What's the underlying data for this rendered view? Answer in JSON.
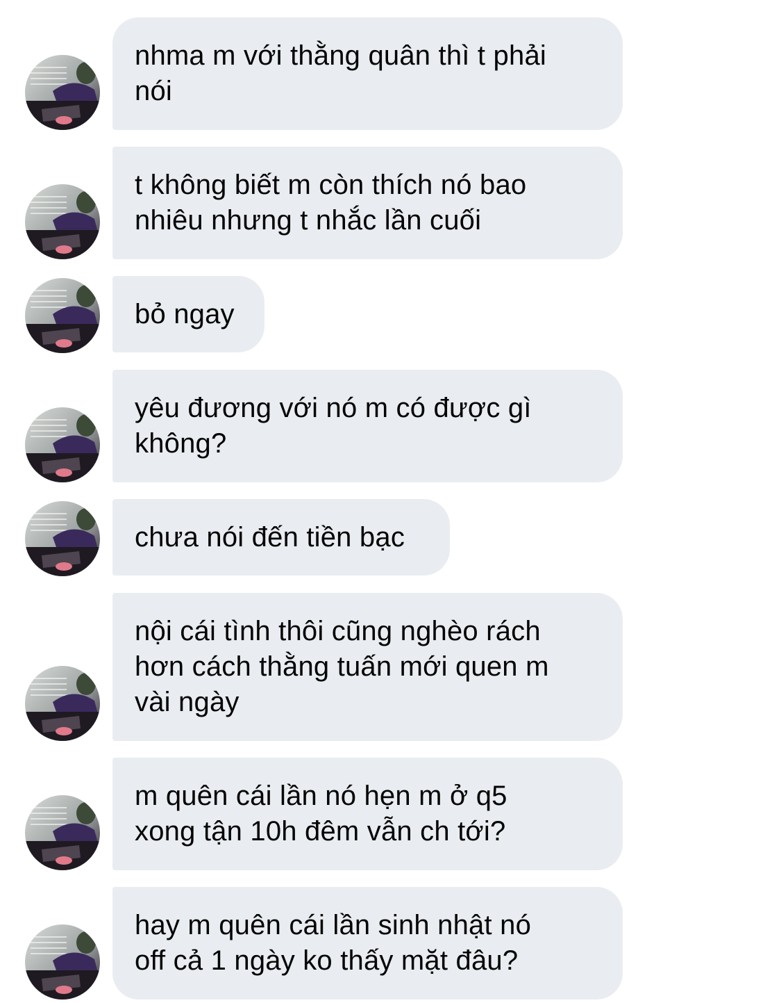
{
  "conversation": {
    "messages": [
      {
        "text": "nhma m với thằng quân thì t phải\nnói",
        "avatar": "profile-photo"
      },
      {
        "text": "t không biết m còn thích nó bao\nnhiêu nhưng t nhắc lần cuối",
        "avatar": "profile-photo"
      },
      {
        "text": "bỏ ngay",
        "avatar": "profile-photo"
      },
      {
        "text": "yêu đương với nó m có được gì\nkhông?",
        "avatar": "profile-photo"
      },
      {
        "text": "chưa nói đến tiền bạc",
        "avatar": "profile-photo"
      },
      {
        "text": "nội cái tình thôi cũng nghèo rách\nhơn cách thằng tuấn mới quen m\nvài ngày",
        "avatar": "profile-photo"
      },
      {
        "text": "m quên cái lần nó hẹn m ở q5\nxong tận 10h đêm vẫn ch tới?",
        "avatar": "profile-photo"
      },
      {
        "text": "hay m quên cái lần sinh nhật nó\noff cả 1 ngày ko thấy mặt đâu?",
        "avatar": "profile-photo"
      }
    ]
  },
  "colors": {
    "bubble_background": "#e9ecf0",
    "text": "#050505",
    "page_background": "#ffffff"
  }
}
